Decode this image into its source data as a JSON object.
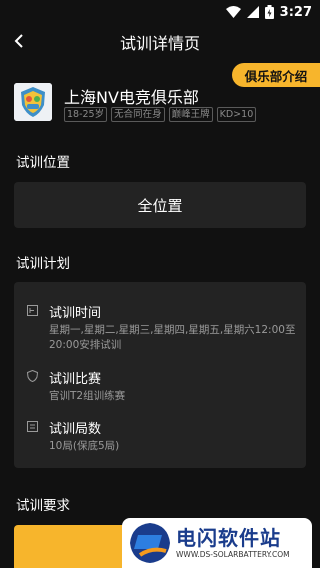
{
  "status_bar": {
    "time": "3:27"
  },
  "nav": {
    "title": "试训详情页"
  },
  "club": {
    "intro_button": "俱乐部介绍",
    "name": "上海NV电竞俱乐部",
    "tags": [
      "18-25岁",
      "无合同在身",
      "巅峰王牌",
      "KD>10"
    ]
  },
  "sections": {
    "position_title": "试训位置",
    "position_value": "全位置",
    "plan_title": "试训计划",
    "requirements_title": "试训要求"
  },
  "plan": {
    "items": [
      {
        "label": "试训时间",
        "text": "星期一,星期二,星期三,星期四,星期五,星期六12:00至20:00安排试训",
        "icon": "calendar-icon"
      },
      {
        "label": "试训比赛",
        "text": "官训T2组训练赛",
        "icon": "shield-icon"
      },
      {
        "label": "试训局数",
        "text": "10局(保底5局)",
        "icon": "list-icon"
      }
    ]
  },
  "watermark": {
    "name": "电闪软件站",
    "url": "WWW.DS-SOLARBATTERY.COM"
  },
  "colors": {
    "accent": "#f7b52c",
    "background": "#111111",
    "card": "#232323"
  }
}
